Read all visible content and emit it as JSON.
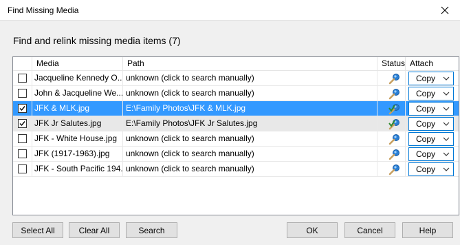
{
  "window": {
    "title": "Find Missing Media"
  },
  "heading": "Find and relink missing media items (7)",
  "columns": {
    "media": "Media",
    "path": "Path",
    "status": "Status",
    "attach": "Attach"
  },
  "rows": [
    {
      "checked": false,
      "selected": false,
      "media": "Jacqueline Kennedy O...",
      "path": "unknown (click to search manually)",
      "status": "search",
      "attach": "Copy"
    },
    {
      "checked": false,
      "selected": false,
      "media": "John & Jacqueline We...",
      "path": "unknown (click to search manually)",
      "status": "search",
      "attach": "Copy"
    },
    {
      "checked": true,
      "selected": true,
      "media": "JFK & MLK.jpg",
      "path": "E:\\Family Photos\\JFK & MLK.jpg",
      "status": "found",
      "attach": "Copy"
    },
    {
      "checked": true,
      "selected": false,
      "media": "JFK Jr Salutes.jpg",
      "path": "E:\\Family Photos\\JFK Jr Salutes.jpg",
      "status": "found",
      "attach": "Copy"
    },
    {
      "checked": false,
      "selected": false,
      "media": "JFK - White House.jpg",
      "path": "unknown (click to search manually)",
      "status": "search",
      "attach": "Copy"
    },
    {
      "checked": false,
      "selected": false,
      "media": "JFK (1917-1963).jpg",
      "path": "unknown (click to search manually)",
      "status": "search",
      "attach": "Copy"
    },
    {
      "checked": false,
      "selected": false,
      "media": "JFK - South Pacific 194...",
      "path": "unknown (click to search manually)",
      "status": "search",
      "attach": "Copy"
    }
  ],
  "buttons": {
    "select_all": "Select All",
    "clear_all": "Clear All",
    "search": "Search",
    "ok": "OK",
    "cancel": "Cancel",
    "help": "Help"
  },
  "colors": {
    "selection": "#3399ff",
    "accent": "#0078d7",
    "icon_blue": "#2a7fd4",
    "icon_tan": "#c8a060",
    "check_green": "#2f8a2f"
  }
}
